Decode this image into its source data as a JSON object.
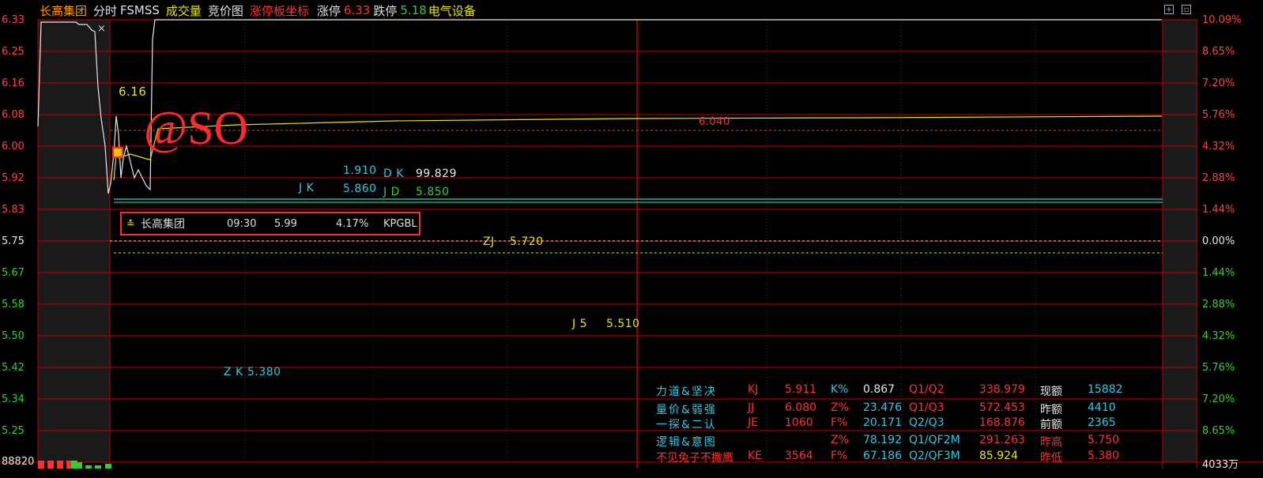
{
  "header": {
    "stock_name": "长高集团",
    "tab_intraday": "分时",
    "tab_fsmss": "FSMSS",
    "tab_volume": "成交量",
    "tab_auction": "竞价图",
    "tab_limit_coord": "涨停板坐标",
    "limit_up_label": "涨停",
    "limit_up_value": "6.33",
    "limit_down_label": "跌停",
    "limit_down_value": "5.18",
    "sector": "电气设备"
  },
  "left_axis": [
    "6.33",
    "6.25",
    "6.16",
    "6.08",
    "6.00",
    "5.92",
    "5.83",
    "5.75",
    "5.67",
    "5.58",
    "5.50",
    "5.42",
    "5.34",
    "5.25"
  ],
  "left_axis_bottom": "88820",
  "right_axis": [
    "10.09%",
    "8.65%",
    "7.20%",
    "5.76%",
    "4.32%",
    "2.88%",
    "1.44%",
    "0.00%",
    "1.44%",
    "2.88%",
    "4.32%",
    "5.76%",
    "7.20%",
    "8.65%"
  ],
  "right_axis_bottom": "4033万",
  "overlay": {
    "price_616": "6.16",
    "watermark": "@SO",
    "close_mark": "×",
    "avg_label": "6.040",
    "v1910": "1.910",
    "dk_label": "D K",
    "dk_value": "99.829",
    "jk_label": "J K",
    "jk_value": "5.860",
    "jd_label": "J D",
    "jd_value": "5.850",
    "zj_label": "ZJ",
    "zj_value": "5.720",
    "j5_label": "J 5",
    "j5_value": "5.510",
    "zk_label": "Z K",
    "zk_value": "5.380"
  },
  "stock_box": {
    "icon": "≛",
    "name": "长高集团",
    "time": "09:30",
    "price": "5.99",
    "pct": "4.17%",
    "code": "KPGBL"
  },
  "stats": [
    {
      "a": "力道&坚决",
      "b": "KJ",
      "c": "5.911",
      "d": "K%",
      "e": "0.867",
      "f": "Q1/Q2",
      "g": "338.979",
      "h": "现额",
      "i": "15882"
    },
    {
      "a": "量价&弱强",
      "b": "JJ",
      "c": "6.080",
      "d": "Z%",
      "e": "23.476",
      "f": "Q1/Q3",
      "g": "572.453",
      "h": "昨额",
      "i": "4410"
    },
    {
      "a": "一探&二认",
      "b": "JE",
      "c": "1060",
      "d": "F%",
      "e": "20.171",
      "f": "Q2/Q3",
      "g": "168.876",
      "h": "前额",
      "i": "2365"
    },
    {
      "a": "逻辑&意图",
      "b": "",
      "c": "",
      "d": "Z%",
      "e": "78.192",
      "f": "Q1/QF2M",
      "g": "291.263",
      "h": "昨高",
      "i": "5.750"
    },
    {
      "a": "不见兔子不撒鹰",
      "b": "KE",
      "c": "3564",
      "d": "F%",
      "e": "67.186",
      "f": "Q2/QF3M",
      "g": "85.924",
      "h": "昨低",
      "i": "5.380"
    }
  ],
  "colors": {
    "grid": "#c00000",
    "up": "#ff4040",
    "down": "#30d030",
    "yellow": "#e6e600",
    "cyan": "#30c8e0",
    "white": "#e8e8e8"
  }
}
